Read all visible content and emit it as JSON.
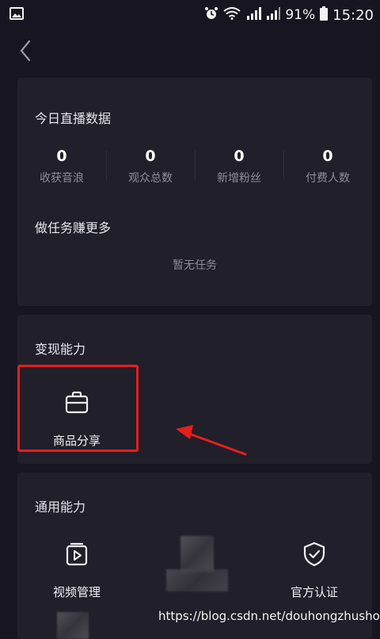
{
  "status_bar": {
    "battery_percent": "91%",
    "time": "15:20"
  },
  "live_card": {
    "title": "今日直播数据",
    "stats": [
      {
        "value": "0",
        "label": "收获音浪"
      },
      {
        "value": "0",
        "label": "观众总数"
      },
      {
        "value": "0",
        "label": "新增粉丝"
      },
      {
        "value": "0",
        "label": "付费人数"
      }
    ],
    "task_title": "做任务赚更多",
    "task_empty": "暂无任务"
  },
  "monetize_card": {
    "title": "变现能力",
    "items": [
      {
        "label": "商品分享",
        "icon": "briefcase-icon"
      }
    ]
  },
  "general_card": {
    "title": "通用能力",
    "items": [
      {
        "label": "视频管理",
        "icon": "video-play-icon"
      },
      {
        "label": "官方认证",
        "icon": "shield-check-icon"
      }
    ]
  },
  "watermark": "https://blog.csdn.net/douhongzhushou",
  "colors": {
    "background": "#171620",
    "card": "#201f2a",
    "highlight": "#e81d1d"
  }
}
